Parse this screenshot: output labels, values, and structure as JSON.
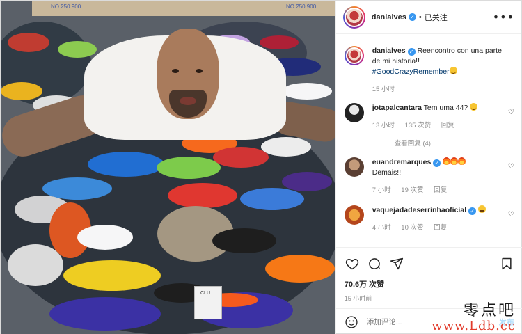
{
  "post": {
    "photo": {
      "alt_icon": "post-photo",
      "box_labels": [
        "NO 250 900",
        "NO 250 900"
      ],
      "card_label": "CLU"
    },
    "author": {
      "username": "danialves",
      "verified": true,
      "separator": "•",
      "follow_label": "已关注",
      "more_icon": "more-options-icon"
    },
    "caption": {
      "username": "danialves",
      "text": "Reencontro con una parte de mi historia!!",
      "hashtag": "#GoodCrazyRemember",
      "emoji": "grinning-face",
      "time": "15 小时"
    },
    "comments": [
      {
        "username": "jotapalcantara",
        "text": "Tem uma 44?",
        "emoji": "grinning-face",
        "time": "13 小时",
        "likes": "135 次赞",
        "reply": "回复"
      },
      {
        "username": "euandremarques",
        "verified": true,
        "emojis": [
          "fire",
          "fire",
          "fire"
        ],
        "text": "Demais!!",
        "time": "7 小时",
        "likes": "19 次赞",
        "reply": "回复"
      },
      {
        "username": "vaquejadadeserrinhaoficial",
        "verified": true,
        "emoji": "thinking-face",
        "time": "4 小时",
        "likes": "10 次赞",
        "reply": "回复"
      }
    ],
    "view_replies": "查看回复 (4)",
    "likes_count": "70.6万 次赞",
    "date": "15 小时前",
    "add_comment_placeholder": "添加评论...",
    "post_button": "发布",
    "icons": [
      "heart-icon",
      "comment-icon",
      "share-icon",
      "bookmark-icon",
      "emoji-icon"
    ]
  },
  "watermark": {
    "chinese": "零点吧",
    "url": "www.Ldb.cc"
  },
  "colors": {
    "link": "#00376b",
    "verified": "#3897f0",
    "muted": "#8e8e8e",
    "watermark_url": "#e23b2b"
  }
}
